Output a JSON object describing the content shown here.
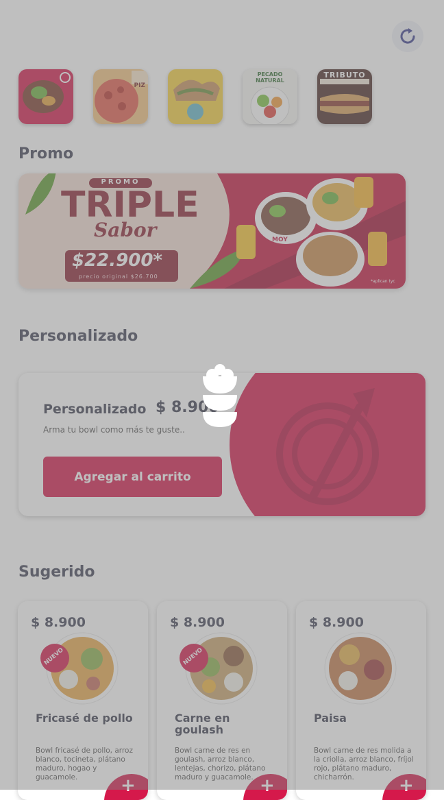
{
  "brands": [
    {
      "name": "Bowl brand",
      "label": "",
      "bg": "#d5194b"
    },
    {
      "name": "Pizza brand",
      "label": "PIZ",
      "bg": "#f2c27e"
    },
    {
      "name": "Wrap brand",
      "label": "",
      "bg": "#f5cf3d"
    },
    {
      "name": "Pecado Natural",
      "label": "PECADO NATURAL",
      "bg": "#f6f6f2"
    },
    {
      "name": "Tributo",
      "label": "TRIBUTO",
      "bg": "#4a2a26"
    }
  ],
  "sections": {
    "promo": "Promo",
    "custom": "Personalizado",
    "suggested": "Sugerido"
  },
  "promo_banner": {
    "tag": "PROMO",
    "headline": "TRIPLE",
    "subhead": "Sabor",
    "price": "$22.900*",
    "original": "precio original $26.700",
    "footnote": "*aplican tyc",
    "brand_on_bowl": "MOY"
  },
  "custom_card": {
    "name": "Personalizado",
    "price": "$ 8.900",
    "description": "Arma tu bowl como más te guste..",
    "button": "Agregar al carrito"
  },
  "products": [
    {
      "price": "$ 8.900",
      "badge": "NUEVO",
      "name": "Fricasé de pollo",
      "description": "Bowl fricasé de pollo, arroz blanco, tocineta, plátano maduro, hogao y guacamole.",
      "add": "+"
    },
    {
      "price": "$ 8.900",
      "badge": "NUEVO",
      "name": "Carne en goulash",
      "description": "Bowl carne de res en goulash, arroz blanco, lentejas, chorizo, plátano maduro y guacamole.",
      "add": "+"
    },
    {
      "price": "$ 8.900",
      "badge": "",
      "name": "Paisa",
      "description": "Bowl carne de res molida a la criolla, arroz blanco, fríjol rojo, plátano maduro, chicharrón.",
      "add": "+"
    }
  ],
  "colors": {
    "accent": "#d5194b",
    "title": "#404356",
    "overlay": "rgba(128,128,128,0.5)"
  },
  "icons": {
    "refresh": "refresh-icon",
    "loader": "rice-bowl-loader-icon"
  }
}
